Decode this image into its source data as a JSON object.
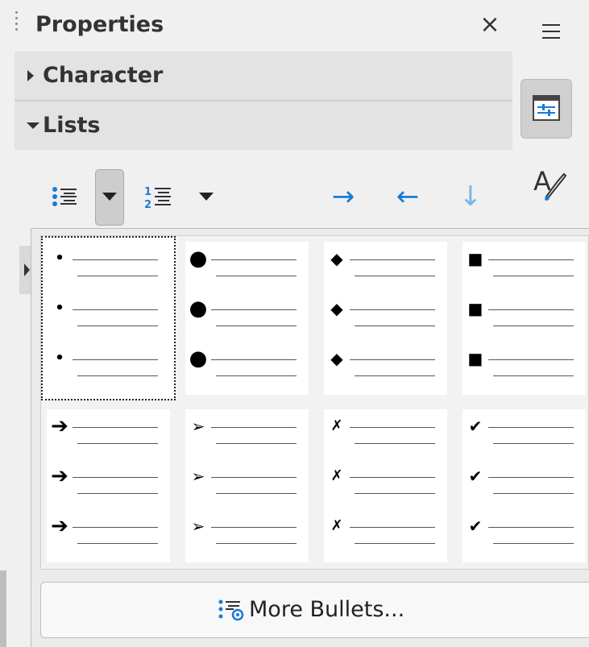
{
  "panel": {
    "title": "Properties",
    "close_icon": "×"
  },
  "sections": {
    "character": {
      "label": "Character",
      "expanded": false
    },
    "lists": {
      "label": "Lists",
      "expanded": true
    }
  },
  "toolbar": {
    "unordered_list_icon": "bullet-list-icon",
    "ordered_list_icon": "numbered-list-icon",
    "increase_indent_icon": "→",
    "decrease_indent_icon": "←",
    "demote_icon": "↓",
    "accent_color": "#1a7ad8"
  },
  "bullets": [
    {
      "symbol": "•",
      "name": "small-dot"
    },
    {
      "symbol": "●",
      "name": "large-dot"
    },
    {
      "symbol": "◆",
      "name": "diamond"
    },
    {
      "symbol": "■",
      "name": "square"
    },
    {
      "symbol": "➔",
      "name": "arrow"
    },
    {
      "symbol": "➢",
      "name": "arrowhead"
    },
    {
      "symbol": "✗",
      "name": "cross"
    },
    {
      "symbol": "✔",
      "name": "check"
    }
  ],
  "more_bullets": {
    "label": "More Bullets..."
  }
}
